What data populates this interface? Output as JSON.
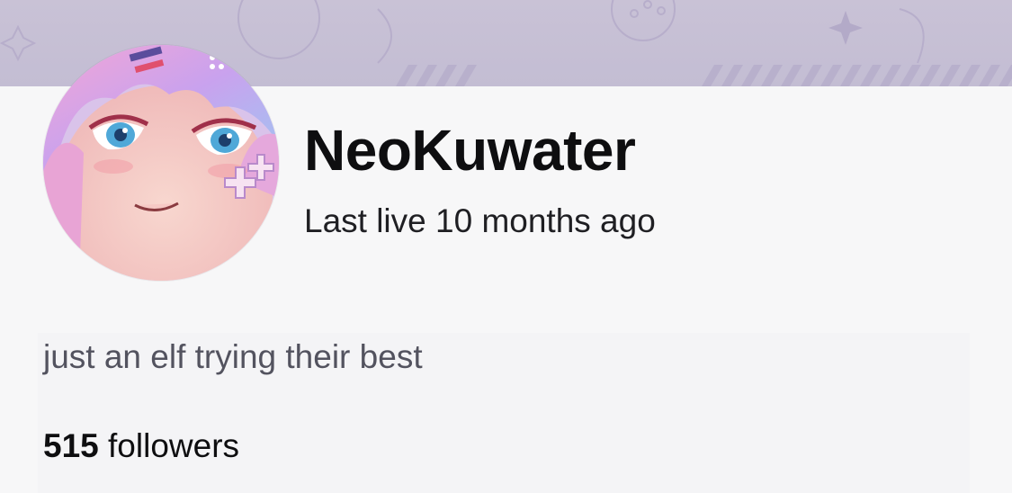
{
  "profile": {
    "username": "NeoKuwater",
    "last_live": "Last live 10 months ago",
    "bio": "just an elf trying their best",
    "followers_count": "515",
    "followers_label": "followers"
  },
  "icons": {
    "avatar": "anime-girl-avatar",
    "banner": "banner-pattern"
  },
  "colors": {
    "banner": "#c6c0d5",
    "background": "#f7f7f8",
    "text_primary": "#0e0e10",
    "text_secondary": "#53535f"
  }
}
